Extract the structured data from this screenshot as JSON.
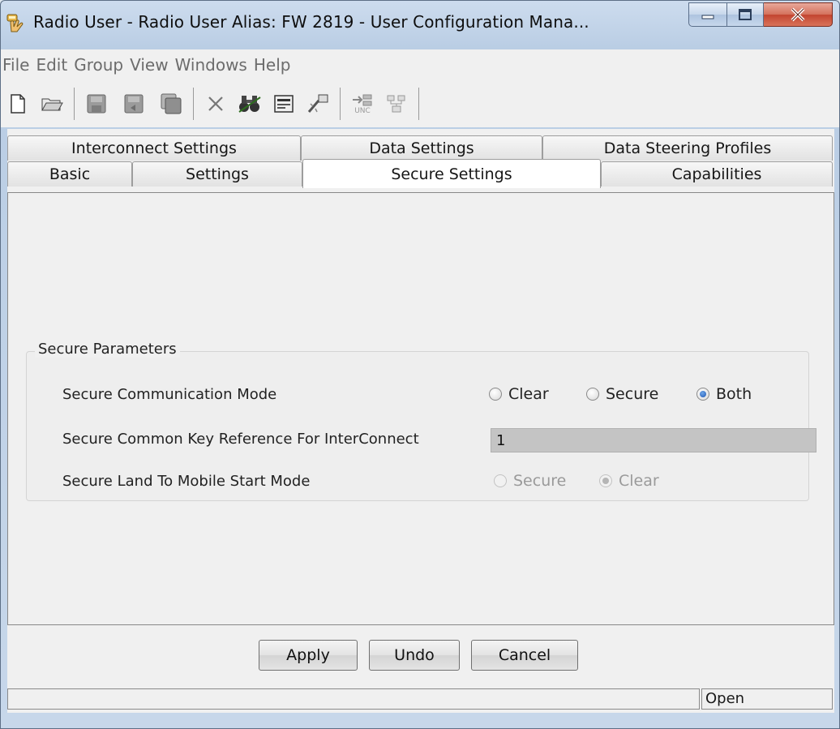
{
  "window": {
    "title": "Radio User - Radio User Alias: FW 2819 - User Configuration Mana...",
    "app_icon": "hand-radio-icon",
    "caption_buttons": [
      "minimize-icon",
      "maximize-icon",
      "close-icon"
    ]
  },
  "menu": {
    "items": [
      "File",
      "Edit",
      "Group",
      "View",
      "Windows",
      "Help"
    ]
  },
  "toolbar": {
    "icons": [
      "new-document-icon",
      "open-folder-icon",
      "disk-icon",
      "disk-back-icon",
      "disk-stack-icon",
      "delete-icon",
      "binoculars-icon",
      "form-icon",
      "wizard-icon",
      "unc-arrow-icon",
      "tree-icon"
    ],
    "unc_label": "UNC"
  },
  "tabs": {
    "row1": [
      "Interconnect Settings",
      "Data Settings",
      "Data Steering Profiles"
    ],
    "row2": [
      "Basic",
      "Settings",
      "Secure Settings",
      "Capabilities"
    ],
    "active": "Secure Settings"
  },
  "secure_parameters": {
    "group_title": "Secure Parameters",
    "comm_mode": {
      "label": "Secure Communication Mode",
      "options": [
        "Clear",
        "Secure",
        "Both"
      ],
      "selected": "Both"
    },
    "key_ref": {
      "label": "Secure Common Key Reference For InterConnect",
      "value": "1"
    },
    "land_to_mobile": {
      "label": "Secure Land To Mobile Start Mode",
      "options": [
        "Secure",
        "Clear"
      ],
      "selected": "Clear",
      "enabled": false
    }
  },
  "buttons": {
    "apply": "Apply",
    "undo": "Undo",
    "cancel": "Cancel"
  },
  "status": {
    "message": "",
    "state": "Open"
  },
  "colors": {
    "accent": "#1e56b4",
    "close_button": "#c24530",
    "disabled_text": "#9a9a9a"
  }
}
